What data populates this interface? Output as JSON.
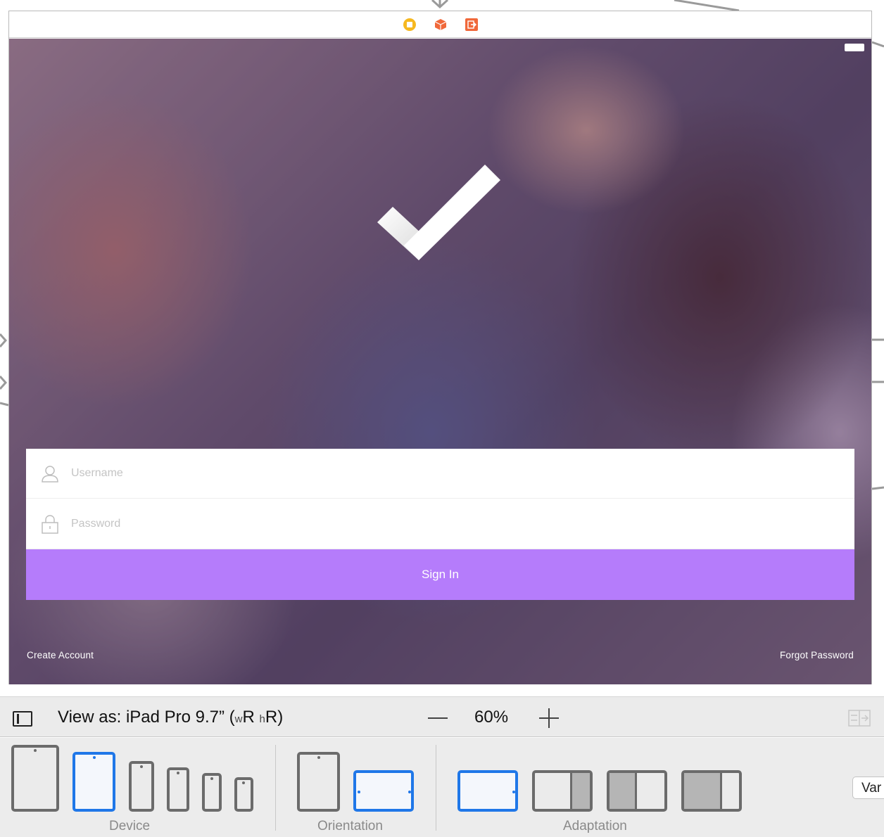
{
  "scene": {
    "dock_icons": [
      "view-controller-icon",
      "first-responder-icon",
      "exit-icon"
    ],
    "status_bar": {
      "battery_icon": "battery-icon"
    },
    "login": {
      "logo_icon": "checkmark-icon",
      "username": {
        "placeholder": "Username",
        "value": "",
        "icon": "user-icon"
      },
      "password": {
        "placeholder": "Password",
        "value": "",
        "icon": "lock-icon"
      },
      "sign_in_label": "Sign In",
      "sign_in_color": "#b57cfb",
      "create_account_label": "Create Account",
      "forgot_password_label": "Forgot Password"
    }
  },
  "view_bar": {
    "view_as_prefix": "View as: iPad Pro 9.7” (",
    "w_label": "w",
    "w_value": "R",
    "h_label": "h",
    "h_value": "R",
    "suffix": ")",
    "zoom": "60%"
  },
  "config_bar": {
    "device_label": "Device",
    "orientation_label": "Orientation",
    "adaptation_label": "Adaptation",
    "vary_label": "Var",
    "accent": "#1f77e8"
  }
}
